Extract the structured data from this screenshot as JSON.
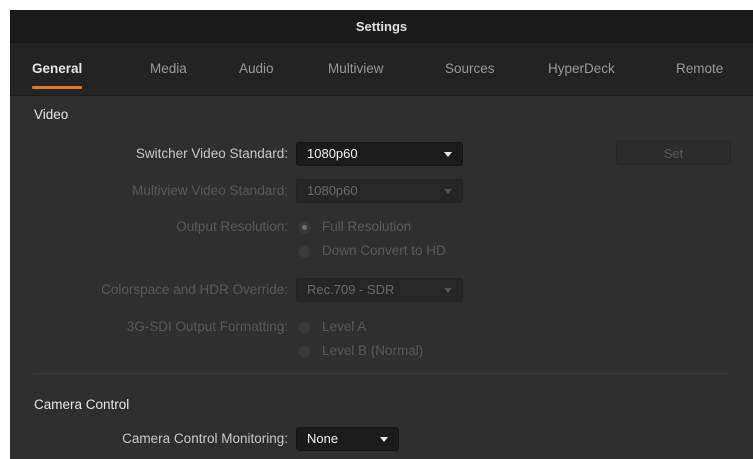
{
  "window": {
    "title": "Settings"
  },
  "tabs": [
    {
      "label": "General",
      "active": true
    },
    {
      "label": "Media",
      "active": false
    },
    {
      "label": "Audio",
      "active": false
    },
    {
      "label": "Multiview",
      "active": false
    },
    {
      "label": "Sources",
      "active": false
    },
    {
      "label": "HyperDeck",
      "active": false
    },
    {
      "label": "Remote",
      "active": false
    }
  ],
  "colors": {
    "accent": "#e5772a",
    "background": "#2f2f2f",
    "tabbar": "#232323",
    "titlebar": "#1a1a1a"
  },
  "video": {
    "section_title": "Video",
    "switcher_standard": {
      "label": "Switcher Video Standard:",
      "value": "1080p60"
    },
    "set_button": "Set",
    "multiview_standard": {
      "label": "Multiview Video Standard:",
      "value": "1080p60"
    },
    "output_resolution": {
      "label": "Output Resolution:",
      "options": [
        "Full Resolution",
        "Down Convert to HD"
      ],
      "selected": "Full Resolution"
    },
    "colorspace": {
      "label": "Colorspace and HDR Override:",
      "value": "Rec.709 - SDR"
    },
    "sdi_formatting": {
      "label": "3G-SDI Output Formatting:",
      "options": [
        "Level A",
        "Level B (Normal)"
      ]
    }
  },
  "camera_control": {
    "section_title": "Camera Control",
    "monitoring": {
      "label": "Camera Control Monitoring:",
      "value": "None"
    }
  }
}
